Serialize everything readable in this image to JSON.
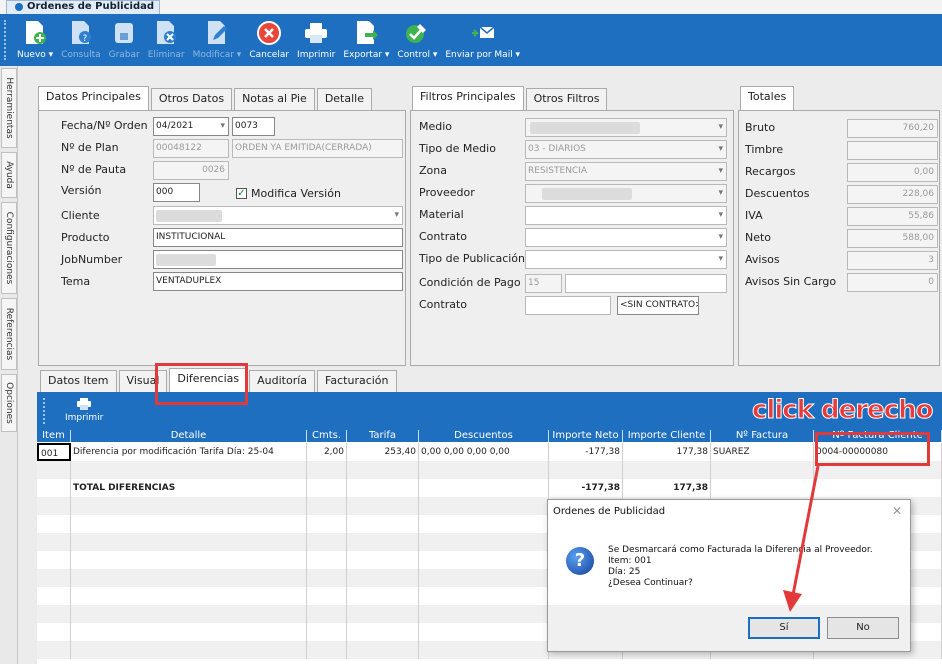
{
  "window": {
    "tab_title": "Ordenes de Publicidad"
  },
  "toolbar": {
    "buttons": [
      {
        "label": "Nuevo ▾",
        "icon": "new-doc-icon",
        "enabled": true
      },
      {
        "label": "Consulta",
        "icon": "query-doc-icon",
        "enabled": false
      },
      {
        "label": "Grabar",
        "icon": "save-icon",
        "enabled": false
      },
      {
        "label": "Eliminar",
        "icon": "delete-doc-icon",
        "enabled": false
      },
      {
        "label": "Modificar ▾",
        "icon": "edit-icon",
        "enabled": false
      },
      {
        "label": "Cancelar",
        "icon": "cancel-icon",
        "enabled": true
      },
      {
        "label": "Imprimir",
        "icon": "printer-icon",
        "enabled": true
      },
      {
        "label": "Exportar ▾",
        "icon": "export-icon",
        "enabled": true
      },
      {
        "label": "Control ▾",
        "icon": "control-icon",
        "enabled": true
      },
      {
        "label": "Enviar por Mail ▾",
        "icon": "mail-icon",
        "enabled": true
      }
    ]
  },
  "side_tabs": [
    "Herramientas",
    "Ayuda",
    "Configuraciones",
    "Referencias",
    "Opciones"
  ],
  "main_tabs": [
    "Datos Principales",
    "Otros Datos",
    "Notas al Pie",
    "Detalle"
  ],
  "datos_principales": {
    "fecha_label": "Fecha/Nº Orden",
    "fecha_value": "04/2021",
    "orden_value": "0073",
    "plan_label": "Nº de Plan",
    "plan_value": "00048122",
    "estado_value": "ORDEN YA EMITIDA(CERRADA)",
    "pauta_label": "Nº de Pauta",
    "pauta_value": "0026",
    "version_label": "Versión",
    "version_value": "000",
    "modifica_label": "Modifica Versión",
    "cliente_label": "Cliente",
    "producto_label": "Producto",
    "producto_value": "INSTITUCIONAL",
    "jobnumber_label": "JobNumber",
    "tema_label": "Tema",
    "tema_value": "VENTADUPLEX"
  },
  "filtros_tabs": [
    "Filtros Principales",
    "Otros Filtros"
  ],
  "filtros": {
    "medio_label": "Medio",
    "tipo_medio_label": "Tipo de Medio",
    "tipo_medio_value": "03 - DIARIOS",
    "zona_label": "Zona",
    "zona_value": "RESISTENCIA",
    "proveedor_label": "Proveedor",
    "material_label": "Material",
    "contrato_label": "Contrato",
    "tipo_pub_label": "Tipo de Publicación",
    "condicion_label": "Condición de Pago",
    "condicion_value": "15",
    "contrato2_label": "Contrato",
    "sin_contrato": "<SIN CONTRATO>"
  },
  "totales_tab": "Totales",
  "totales": [
    {
      "label": "Bruto",
      "value": "760,20"
    },
    {
      "label": "Timbre",
      "value": ""
    },
    {
      "label": "Recargos",
      "value": "0,00"
    },
    {
      "label": "Descuentos",
      "value": "228,06"
    },
    {
      "label": "IVA",
      "value": "55,86"
    },
    {
      "label": "Neto",
      "value": "588,00"
    },
    {
      "label": "Avisos",
      "value": "3"
    },
    {
      "label": "Avisos Sin Cargo",
      "value": "0"
    }
  ],
  "bottom_tabs": [
    "Datos Item",
    "Visual",
    "Diferencias",
    "Auditoría",
    "Facturación"
  ],
  "grid": {
    "print_label": "Imprimir",
    "headers": [
      "Item",
      "Detalle",
      "Cmts.",
      "Tarifa",
      "Descuentos",
      "Importe Neto",
      "Importe Cliente",
      "Nº Factura",
      "Nº Factura Cliente"
    ],
    "row1": [
      "001",
      "Diferencia por modificación Tarifa Día: 25-04",
      "2,00",
      "253,40",
      "0,00 0,00 0,00 0,00",
      "-177,38",
      "177,38",
      "SUAREZ",
      "0004-00000080"
    ],
    "total_label": "TOTAL DIFERENCIAS",
    "total_neto": "-177,38",
    "total_cliente": "177,38"
  },
  "dialog": {
    "title": "Ordenes de Publicidad",
    "line1": "Se Desmarcará como Facturada la Diferencia al Proveedor.",
    "line2": "Item: 001",
    "line3": "Día: 25",
    "line4": "¿Desea Continuar?",
    "yes": "Sí",
    "no": "No"
  },
  "annotation": {
    "text": "click derecho",
    "color": "#e83a3a"
  }
}
